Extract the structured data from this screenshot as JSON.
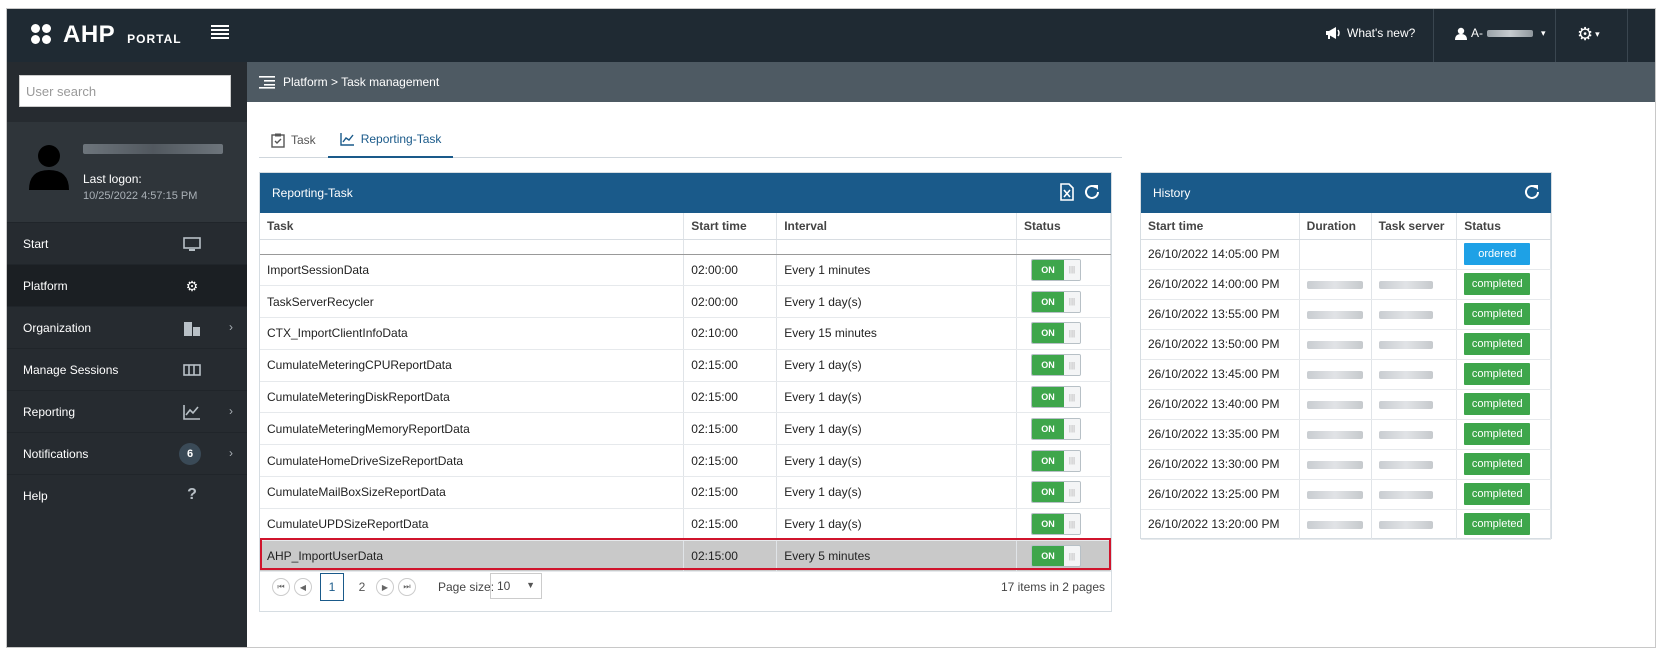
{
  "app": {
    "logo_main": "AHP",
    "logo_sub": "PORTAL"
  },
  "topbar": {
    "whats_new": "What's new?",
    "user": "A-",
    "settings_caret": "▾"
  },
  "sidebar": {
    "search_placeholder": "User search",
    "last_logon_label": "Last logon:",
    "last_logon_value": "10/25/2022 4:57:15 PM",
    "items": [
      {
        "label": "Start",
        "icon": "monitor-icon"
      },
      {
        "label": "Platform",
        "icon": "gears-icon"
      },
      {
        "label": "Organization",
        "icon": "building-icon"
      },
      {
        "label": "Manage Sessions",
        "icon": "sessions-icon"
      },
      {
        "label": "Reporting",
        "icon": "chart-icon"
      },
      {
        "label": "Notifications",
        "icon": "bell-icon",
        "badge": "6"
      },
      {
        "label": "Help",
        "icon": "help-icon"
      }
    ]
  },
  "breadcrumb": {
    "text": "Platform > Task management"
  },
  "tabs": [
    {
      "label": "Task"
    },
    {
      "label": "Reporting-Task"
    }
  ],
  "task_panel": {
    "title": "Reporting-Task",
    "columns": [
      "Task",
      "Start time",
      "Interval",
      "Status"
    ],
    "toggle_label": "ON",
    "rows": [
      {
        "task": "ImportSessionData",
        "start": "02:00:00",
        "interval": "Every 1 minutes"
      },
      {
        "task": "TaskServerRecycler",
        "start": "02:00:00",
        "interval": "Every 1 day(s)"
      },
      {
        "task": "CTX_ImportClientInfoData",
        "start": "02:10:00",
        "interval": "Every 15 minutes"
      },
      {
        "task": "CumulateMeteringCPUReportData",
        "start": "02:15:00",
        "interval": "Every 1 day(s)"
      },
      {
        "task": "CumulateMeteringDiskReportData",
        "start": "02:15:00",
        "interval": "Every 1 day(s)"
      },
      {
        "task": "CumulateMeteringMemoryReportData",
        "start": "02:15:00",
        "interval": "Every 1 day(s)"
      },
      {
        "task": "CumulateHomeDriveSizeReportData",
        "start": "02:15:00",
        "interval": "Every 1 day(s)"
      },
      {
        "task": "CumulateMailBoxSizeReportData",
        "start": "02:15:00",
        "interval": "Every 1 day(s)"
      },
      {
        "task": "CumulateUPDSizeReportData",
        "start": "02:15:00",
        "interval": "Every 1 day(s)"
      },
      {
        "task": "AHP_ImportUserData",
        "start": "02:15:00",
        "interval": "Every 5 minutes"
      }
    ],
    "pager": {
      "page1": "1",
      "page2": "2",
      "page_size_label": "Page size:",
      "page_size": "10",
      "info": "17 items in 2 pages"
    }
  },
  "history_panel": {
    "title": "History",
    "columns": [
      "Start time",
      "Duration",
      "Task server",
      "Status"
    ],
    "rows": [
      {
        "start": "26/10/2022 14:05:00 PM",
        "status": "ordered"
      },
      {
        "start": "26/10/2022 14:00:00 PM",
        "status": "completed"
      },
      {
        "start": "26/10/2022 13:55:00 PM",
        "status": "completed"
      },
      {
        "start": "26/10/2022 13:50:00 PM",
        "status": "completed"
      },
      {
        "start": "26/10/2022 13:45:00 PM",
        "status": "completed"
      },
      {
        "start": "26/10/2022 13:40:00 PM",
        "status": "completed"
      },
      {
        "start": "26/10/2022 13:35:00 PM",
        "status": "completed"
      },
      {
        "start": "26/10/2022 13:30:00 PM",
        "status": "completed"
      },
      {
        "start": "26/10/2022 13:25:00 PM",
        "status": "completed"
      },
      {
        "start": "26/10/2022 13:20:00 PM",
        "status": "completed"
      }
    ]
  },
  "colors": {
    "topbar": "#1f2a33",
    "sidebar": "#262b30",
    "panel_header": "#1a5a8a",
    "on_green": "#3ea64b",
    "ordered_blue": "#1ea1e6",
    "highlight_border": "#d0142c"
  }
}
